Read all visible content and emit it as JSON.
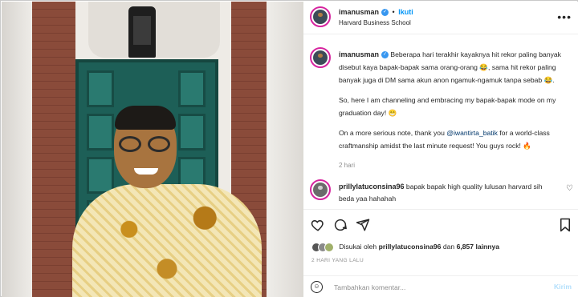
{
  "post": {
    "author": "imanusman",
    "follow_label": "Ikuti",
    "follow_separator": "•",
    "location": "Harvard Business School",
    "more_icon": "more-horizontal-icon",
    "verified_icon": "verified-badge-icon"
  },
  "caption": {
    "author": "imanusman",
    "paragraph1": "Beberapa hari terakhir kayaknya hit rekor paling banyak disebut kaya bapak-bapak sama orang-orang 😂, sama hit rekor paling banyak juga di DM sama akun anon ngamuk-ngamuk tanpa sebab 😂.",
    "paragraph2": "So, here I am channeling and embracing my bapak-bapak mode on my graduation day! 😁",
    "paragraph3_before": "On a more serious note, thank you ",
    "paragraph3_mention": "@iwantirta_batik",
    "paragraph3_after": " for a world-class craftmanship amidst the last minute request! You guys rock! 🔥",
    "time": "2 hari"
  },
  "comments": [
    {
      "user": "prillylatuconsina96",
      "text": "bapak bapak high quality lulusan harvard sih beda yaa hahahah"
    }
  ],
  "actions": {
    "like_icon": "heart-icon",
    "comment_icon": "comment-icon",
    "share_icon": "share-icon",
    "save_icon": "bookmark-icon"
  },
  "likes": {
    "prefix": "Disukai oleh",
    "user": "prillylatuconsina96",
    "joiner": "dan",
    "count": "6,857 lainnya"
  },
  "posted_ago": "2 HARI YANG LALU",
  "add_comment": {
    "placeholder": "Tambahkan komentar...",
    "post_label": "Kirim",
    "emoji_icon": "emoji-icon"
  },
  "colors": {
    "link_blue": "#0095f6",
    "verified_blue": "#3897f0",
    "story_ring": "#d6249f",
    "post_disabled": "#b2dffc"
  }
}
